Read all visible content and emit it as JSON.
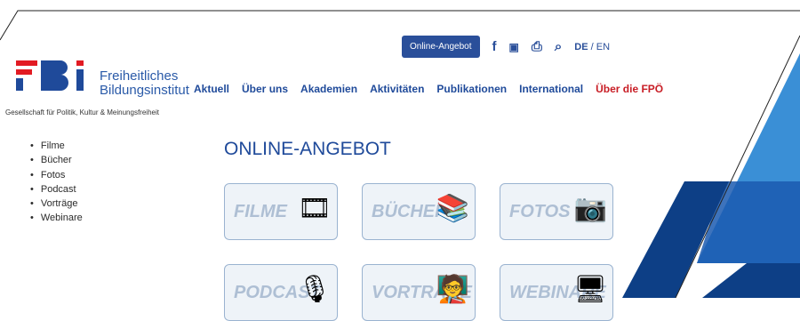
{
  "header": {
    "logo_main": "Freiheitliches",
    "logo_sub": "Bildungsinstitut",
    "tagline": "Gesellschaft für Politik, Kultur & Meinungsfreiheit",
    "online_button": "Online-Angebot",
    "icons": [
      "facebook-icon",
      "youtube-icon",
      "print-icon",
      "search-icon"
    ],
    "lang_de": "DE",
    "lang_sep": "/",
    "lang_en": "EN"
  },
  "nav": {
    "items": [
      "Aktuell",
      "Über uns",
      "Akademien",
      "Aktivitäten",
      "Publikationen",
      "International",
      "Über die FPÖ"
    ]
  },
  "sidebar": {
    "items": [
      "Filme",
      "Bücher",
      "Fotos",
      "Podcast",
      "Vorträge",
      "Webinare"
    ]
  },
  "main": {
    "title": "ONLINE-ANGEBOT",
    "cards": [
      "FILME",
      "BÜCHER",
      "FOTOS",
      "PODCAST",
      "VORTRÄGE",
      "WEBINARE"
    ]
  },
  "colors": {
    "brand_blue": "#2a4f9a",
    "accent_red": "#c81d25",
    "logo_red": "#e21b23"
  }
}
